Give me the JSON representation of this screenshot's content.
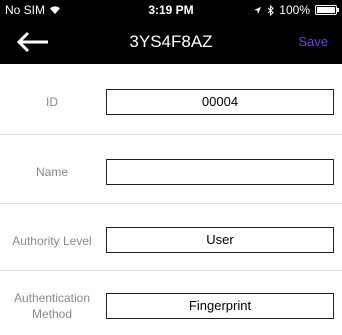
{
  "status_bar": {
    "carrier": "No SIM",
    "time": "3:19 PM",
    "battery": "100%",
    "wifi_icon": "wifi-icon",
    "location_icon": "location-arrow-icon",
    "bluetooth_icon": "bluetooth-icon",
    "battery_level": 1.0
  },
  "nav": {
    "back_icon": "arrow-left-icon",
    "title": "3YS4F8AZ",
    "save_label": "Save",
    "save_color": "#6b3fd6"
  },
  "form": {
    "id_label": "ID",
    "id_value": "00004",
    "name_label": "Name",
    "name_value": "",
    "authority_label": "Authority Level",
    "authority_value": "User",
    "auth_method_label_line1": "Authentication",
    "auth_method_label_line2": "Method",
    "auth_method_value": "Fingerprint"
  }
}
